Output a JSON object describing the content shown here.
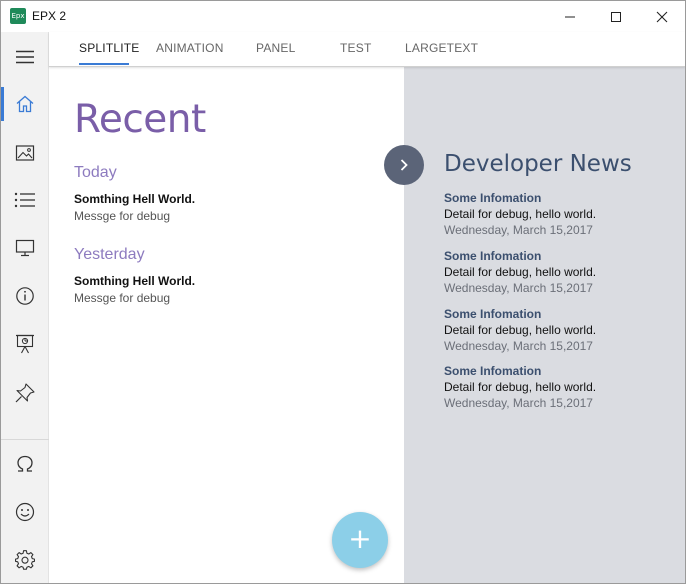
{
  "window": {
    "app_icon_text": "Epx",
    "title": "EPX 2"
  },
  "tabs": [
    {
      "label": "SPLITLITE"
    },
    {
      "label": "ANIMATION"
    },
    {
      "label": "PANEL"
    },
    {
      "label": "TEST"
    },
    {
      "label": "LARGETEXT"
    }
  ],
  "sidebar": {
    "items": [
      {
        "icon": "hamburger-menu-icon"
      },
      {
        "icon": "home-icon",
        "active": true
      },
      {
        "icon": "image-icon"
      },
      {
        "icon": "list-icon"
      },
      {
        "icon": "monitor-icon"
      },
      {
        "icon": "info-icon"
      },
      {
        "icon": "presentation-icon"
      },
      {
        "icon": "pin-icon"
      },
      {
        "icon": "omega-icon"
      },
      {
        "icon": "smiley-icon"
      },
      {
        "icon": "gear-icon"
      }
    ],
    "accent": "#3a7bd5"
  },
  "main": {
    "title": "Recent",
    "groups": [
      {
        "header": "Today",
        "items": [
          {
            "title": "Somthing Hell World.",
            "subtitle": "Messge for debug"
          }
        ]
      },
      {
        "header": "Yesterday",
        "items": [
          {
            "title": "Somthing Hell World.",
            "subtitle": "Messge for debug"
          }
        ]
      }
    ],
    "fab_label": "+"
  },
  "news": {
    "title": "Developer News",
    "items": [
      {
        "heading": "Some Infomation",
        "detail": "Detail for debug, hello world.",
        "date": "Wednesday, March 15,2017"
      },
      {
        "heading": "Some Infomation",
        "detail": "Detail for debug, hello world.",
        "date": "Wednesday, March 15,2017"
      },
      {
        "heading": "Some Infomation",
        "detail": "Detail for debug, hello world.",
        "date": "Wednesday, March 15,2017"
      },
      {
        "heading": "Some Infomation",
        "detail": "Detail for debug, hello world.",
        "date": "Wednesday, March 15,2017"
      }
    ]
  },
  "colors": {
    "title_purple": "#7a5ea8",
    "group_purple": "#8d7bbf",
    "pane_background": "#dadce1",
    "news_navy": "#3b4f6e",
    "fab_blue": "#8ccfe8",
    "collapse_button": "#5b6478"
  }
}
